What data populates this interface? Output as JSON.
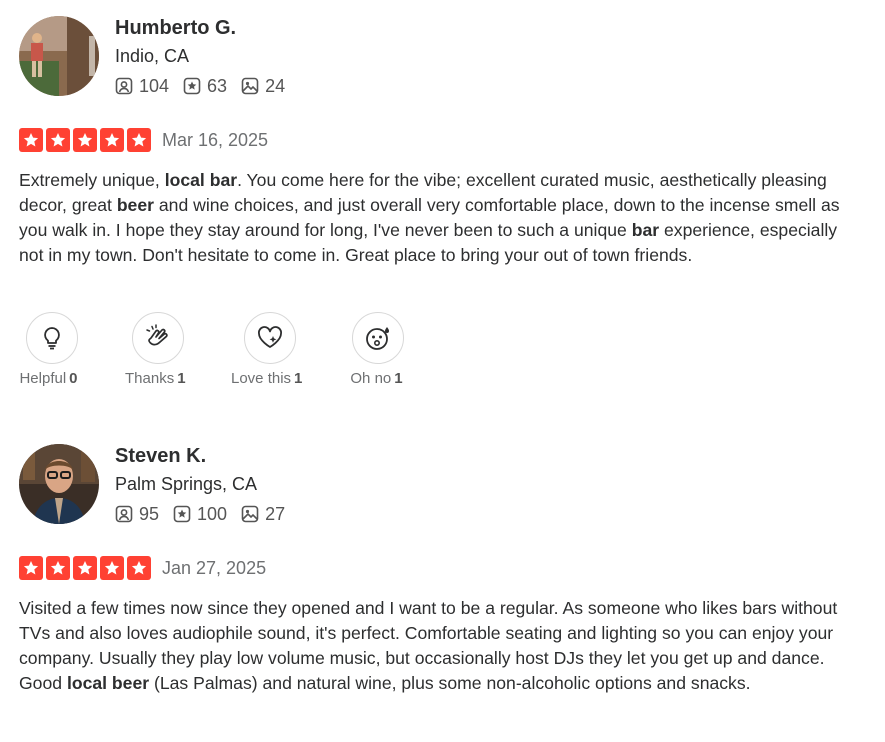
{
  "reviews": [
    {
      "user": {
        "name": "Humberto G.",
        "location": "Indio, CA",
        "friends": "104",
        "reviews": "63",
        "photos": "24",
        "avatar_icon": "avatar-photo-hiker"
      },
      "rating": 5,
      "date": "Mar 16, 2025",
      "text_segments": [
        {
          "t": "Extremely unique, ",
          "b": false
        },
        {
          "t": "local bar",
          "b": true
        },
        {
          "t": ". You come here for the vibe; excellent curated music, aesthetically pleasing decor, great ",
          "b": false
        },
        {
          "t": "beer",
          "b": true
        },
        {
          "t": " and wine choices, and just overall very comfortable place, down to the incense smell as you walk in. I hope they stay around for long, I've never been to such a unique ",
          "b": false
        },
        {
          "t": "bar",
          "b": true
        },
        {
          "t": " experience, especially not in my town. Don't hesitate to come in. Great place to bring your out of town friends.",
          "b": false
        }
      ],
      "reactions": [
        {
          "label": "Helpful",
          "count": "0",
          "icon": "lightbulb-icon"
        },
        {
          "label": "Thanks",
          "count": "1",
          "icon": "clapping-hands-icon"
        },
        {
          "label": "Love this",
          "count": "1",
          "icon": "heart-sparkle-icon"
        },
        {
          "label": "Oh no",
          "count": "1",
          "icon": "surprised-face-icon"
        }
      ]
    },
    {
      "user": {
        "name": "Steven K.",
        "location": "Palm Springs, CA",
        "friends": "95",
        "reviews": "100",
        "photos": "27",
        "avatar_icon": "avatar-photo-person"
      },
      "rating": 5,
      "date": "Jan 27, 2025",
      "text_segments": [
        {
          "t": "Visited a few times now since they opened and I want to be a regular. As someone who likes bars without TVs and also loves audiophile sound, it's perfect. Comfortable seating and lighting so you can enjoy your company. Usually they play low volume music, but occasionally host DJs they let you get up and dance. Good ",
          "b": false
        },
        {
          "t": "local beer",
          "b": true
        },
        {
          "t": " (Las Palmas) and natural wine, plus some non-alcoholic options and snacks.",
          "b": false
        }
      ]
    }
  ],
  "colors": {
    "star": "#ff4133",
    "text": "#2d2e2f",
    "muted": "#6e7072"
  }
}
